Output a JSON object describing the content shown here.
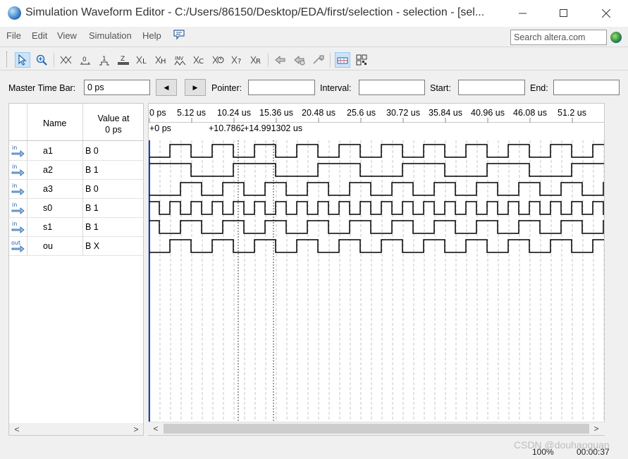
{
  "window": {
    "title": "Simulation Waveform Editor - C:/Users/86150/Desktop/EDA/first/selection - selection - [sel...",
    "controls": [
      "minimize",
      "maximize",
      "close"
    ]
  },
  "menu": {
    "items": [
      "File",
      "Edit",
      "View",
      "Simulation",
      "Help"
    ],
    "help_icon": "speech-bubble-icon"
  },
  "search": {
    "placeholder": "Search altera.com"
  },
  "toolbar": {
    "buttons": [
      "selection-tool",
      "zoom-tool",
      "force-unknown",
      "force-low",
      "force-high",
      "force-high-impedance",
      "force-weak-low",
      "force-weak-high",
      "invert",
      "count-value",
      "forcing-clock",
      "arbitrary-value",
      "random-values",
      "run-functional-simulation",
      "run-timing-simulation",
      "generate-netlist",
      "snap-to-grid",
      "grid-settings"
    ]
  },
  "controls": {
    "master_time_bar_label": "Master Time Bar:",
    "master_time_bar_value": "0 ps",
    "prev_button": "◀",
    "next_button": "▶",
    "pointer_label": "Pointer:",
    "pointer_value": "",
    "interval_label": "Interval:",
    "interval_value": "",
    "start_label": "Start:",
    "start_value": "",
    "end_label": "End:",
    "end_value": ""
  },
  "signals_header": {
    "name": "Name",
    "value_line1": "Value at",
    "value_line2": "0 ps"
  },
  "signals": [
    {
      "type": "in",
      "name": "a1",
      "value": "B 0"
    },
    {
      "type": "in",
      "name": "a2",
      "value": "B 1"
    },
    {
      "type": "in",
      "name": "a3",
      "value": "B 0"
    },
    {
      "type": "in",
      "name": "s0",
      "value": "B 1"
    },
    {
      "type": "in",
      "name": "s1",
      "value": "B 1"
    },
    {
      "type": "out",
      "name": "ou",
      "value": "B X"
    }
  ],
  "ruler": {
    "ticks": [
      "0 ps",
      "5.12 us",
      "10.24 us",
      "15.36 us",
      "20.48 us",
      "25.6 us",
      "30.72 us",
      "35.84 us",
      "40.96 us",
      "46.08 us",
      "51.2 us"
    ],
    "cursor_labels": [
      "+0 ps",
      "+10.7862",
      "+14.991302 us"
    ]
  },
  "status": {
    "zoom": "100%",
    "time": "00:00:37"
  },
  "watermark": "CSDN @douhaoguan"
}
